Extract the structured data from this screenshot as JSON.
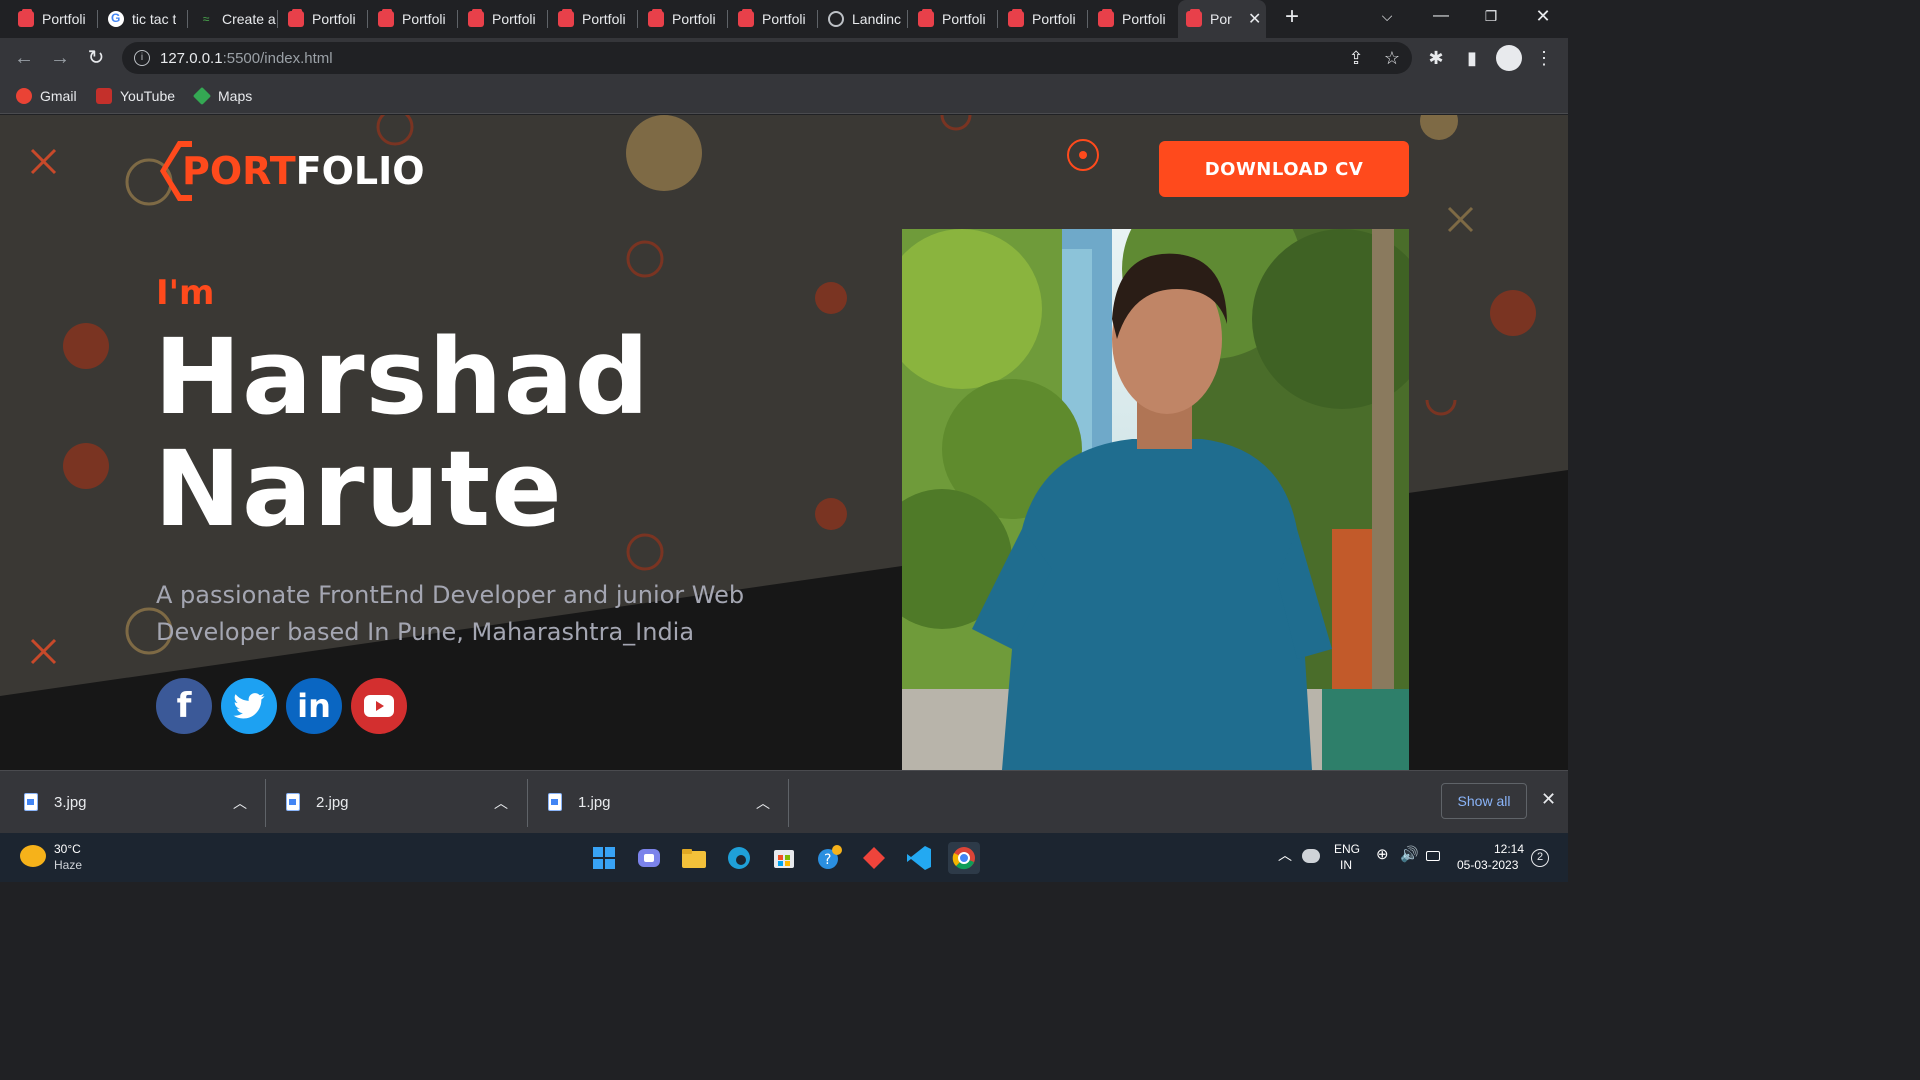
{
  "browser": {
    "tabs": [
      {
        "title": "Portfoli",
        "icon": "portfolio-icon"
      },
      {
        "title": "tic tac t",
        "icon": "google-icon"
      },
      {
        "title": "Create a",
        "icon": "create-icon"
      },
      {
        "title": "Portfoli",
        "icon": "portfolio-icon"
      },
      {
        "title": "Portfoli",
        "icon": "portfolio-icon"
      },
      {
        "title": "Portfoli",
        "icon": "portfolio-icon"
      },
      {
        "title": "Portfoli",
        "icon": "portfolio-icon"
      },
      {
        "title": "Portfoli",
        "icon": "portfolio-icon"
      },
      {
        "title": "Portfoli",
        "icon": "portfolio-icon"
      },
      {
        "title": "Landinc",
        "icon": "globe-icon"
      },
      {
        "title": "Portfoli",
        "icon": "portfolio-icon"
      },
      {
        "title": "Portfoli",
        "icon": "portfolio-icon"
      },
      {
        "title": "Portfoli",
        "icon": "portfolio-icon"
      },
      {
        "title": "Por",
        "icon": "portfolio-icon",
        "active": true
      }
    ],
    "url_host": "127.0.0.1",
    "url_path": ":5500/index.html",
    "bookmarks": [
      "Gmail",
      "YouTube",
      "Maps"
    ]
  },
  "site": {
    "logo_accent": "P",
    "logo_accent2": "ORT",
    "logo_rest": "FOLIO",
    "download_cv": "DOWNLOAD CV",
    "intro": "I'm",
    "first_name": "Harshad",
    "last_name": "Narute",
    "description": "A passionate FrontEnd Developer and junior Web Developer based In Pune, Maharashtra_India",
    "socials": [
      {
        "name": "facebook",
        "glyph": "f",
        "color": "#3b5998"
      },
      {
        "name": "twitter",
        "glyph": "🐦",
        "color": "#1da1f2"
      },
      {
        "name": "linkedin",
        "glyph": "in",
        "color": "#0a66c2"
      },
      {
        "name": "youtube",
        "glyph": "▶",
        "color": "#d32f2f"
      }
    ],
    "accent_color": "#ff4a1c"
  },
  "downloads": {
    "items": [
      "3.jpg",
      "2.jpg",
      "1.jpg"
    ],
    "show_all": "Show all"
  },
  "taskbar": {
    "weather_temp": "30°C",
    "weather_desc": "Haze",
    "lang1": "ENG",
    "lang2": "IN",
    "time": "12:14",
    "date": "05-03-2023",
    "notifications": "2"
  }
}
